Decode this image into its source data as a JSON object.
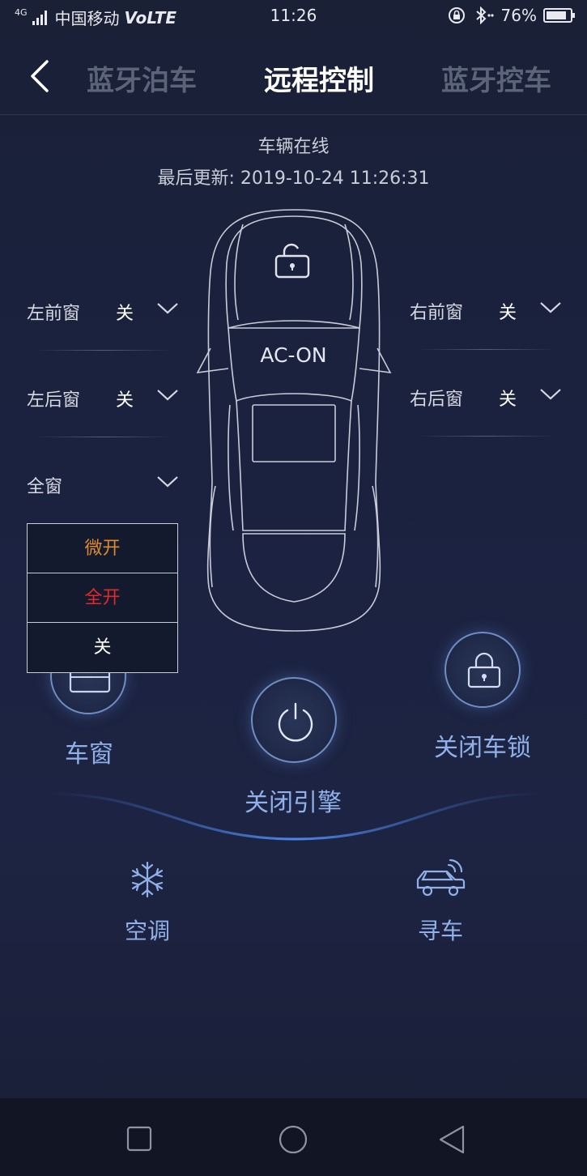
{
  "status_bar": {
    "signal": "4G",
    "carrier": "中国移动",
    "volte": "VoLTE",
    "time": "11:26",
    "battery": "76%"
  },
  "header": {
    "tabs": [
      {
        "label": "蓝牙泊车"
      },
      {
        "label": "远程控制"
      },
      {
        "label": "蓝牙控车"
      }
    ]
  },
  "vehicle": {
    "status": "车辆在线",
    "last_update": "最后更新: 2019-10-24 11:26:31",
    "ac_status": "AC-ON"
  },
  "windows": {
    "front_left": {
      "label": "左前窗",
      "value": "关"
    },
    "rear_left": {
      "label": "左后窗",
      "value": "关"
    },
    "front_right": {
      "label": "右前窗",
      "value": "关"
    },
    "rear_right": {
      "label": "右后窗",
      "value": "关"
    },
    "all": {
      "label": "全窗"
    }
  },
  "dropdown": {
    "options": [
      {
        "label": "微开",
        "color": "#e08a2e"
      },
      {
        "label": "全开",
        "color": "#e02a2a"
      },
      {
        "label": "关",
        "color": "#ffffff"
      }
    ]
  },
  "actions": {
    "window": "车窗",
    "engine": "关闭引擎",
    "lock": "关闭车锁",
    "ac": "空调",
    "find_car": "寻车"
  },
  "colors": {
    "accent": "#8fb0e8",
    "background": "#1b2240"
  }
}
